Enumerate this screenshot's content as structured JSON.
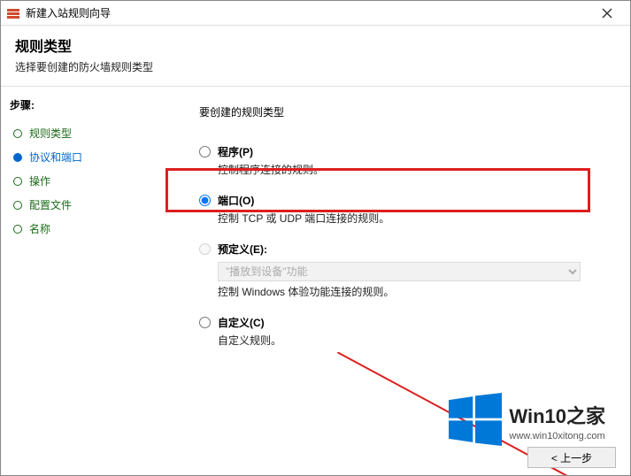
{
  "window": {
    "title": "新建入站规则向导"
  },
  "header": {
    "title": "规则类型",
    "subtitle": "选择要创建的防火墙规则类型"
  },
  "sidebar": {
    "steps_title": "步骤:",
    "items": [
      {
        "label": "规则类型"
      },
      {
        "label": "协议和端口"
      },
      {
        "label": "操作"
      },
      {
        "label": "配置文件"
      },
      {
        "label": "名称"
      }
    ]
  },
  "main": {
    "prompt": "要创建的规则类型",
    "options": {
      "program": {
        "label": "程序(P)",
        "desc": "控制程序连接的规则。"
      },
      "port": {
        "label": "端口(O)",
        "desc": "控制 TCP 或 UDP 端口连接的规则。"
      },
      "predef": {
        "label": "预定义(E):",
        "select": "\"播放到设备\"功能",
        "desc": "控制 Windows 体验功能连接的规则。"
      },
      "custom": {
        "label": "自定义(C)",
        "desc": "自定义规则。"
      }
    }
  },
  "buttons": {
    "back": "< 上一步"
  },
  "watermark": {
    "brand": "Win10之家",
    "url": "www.win10xitong.com"
  }
}
